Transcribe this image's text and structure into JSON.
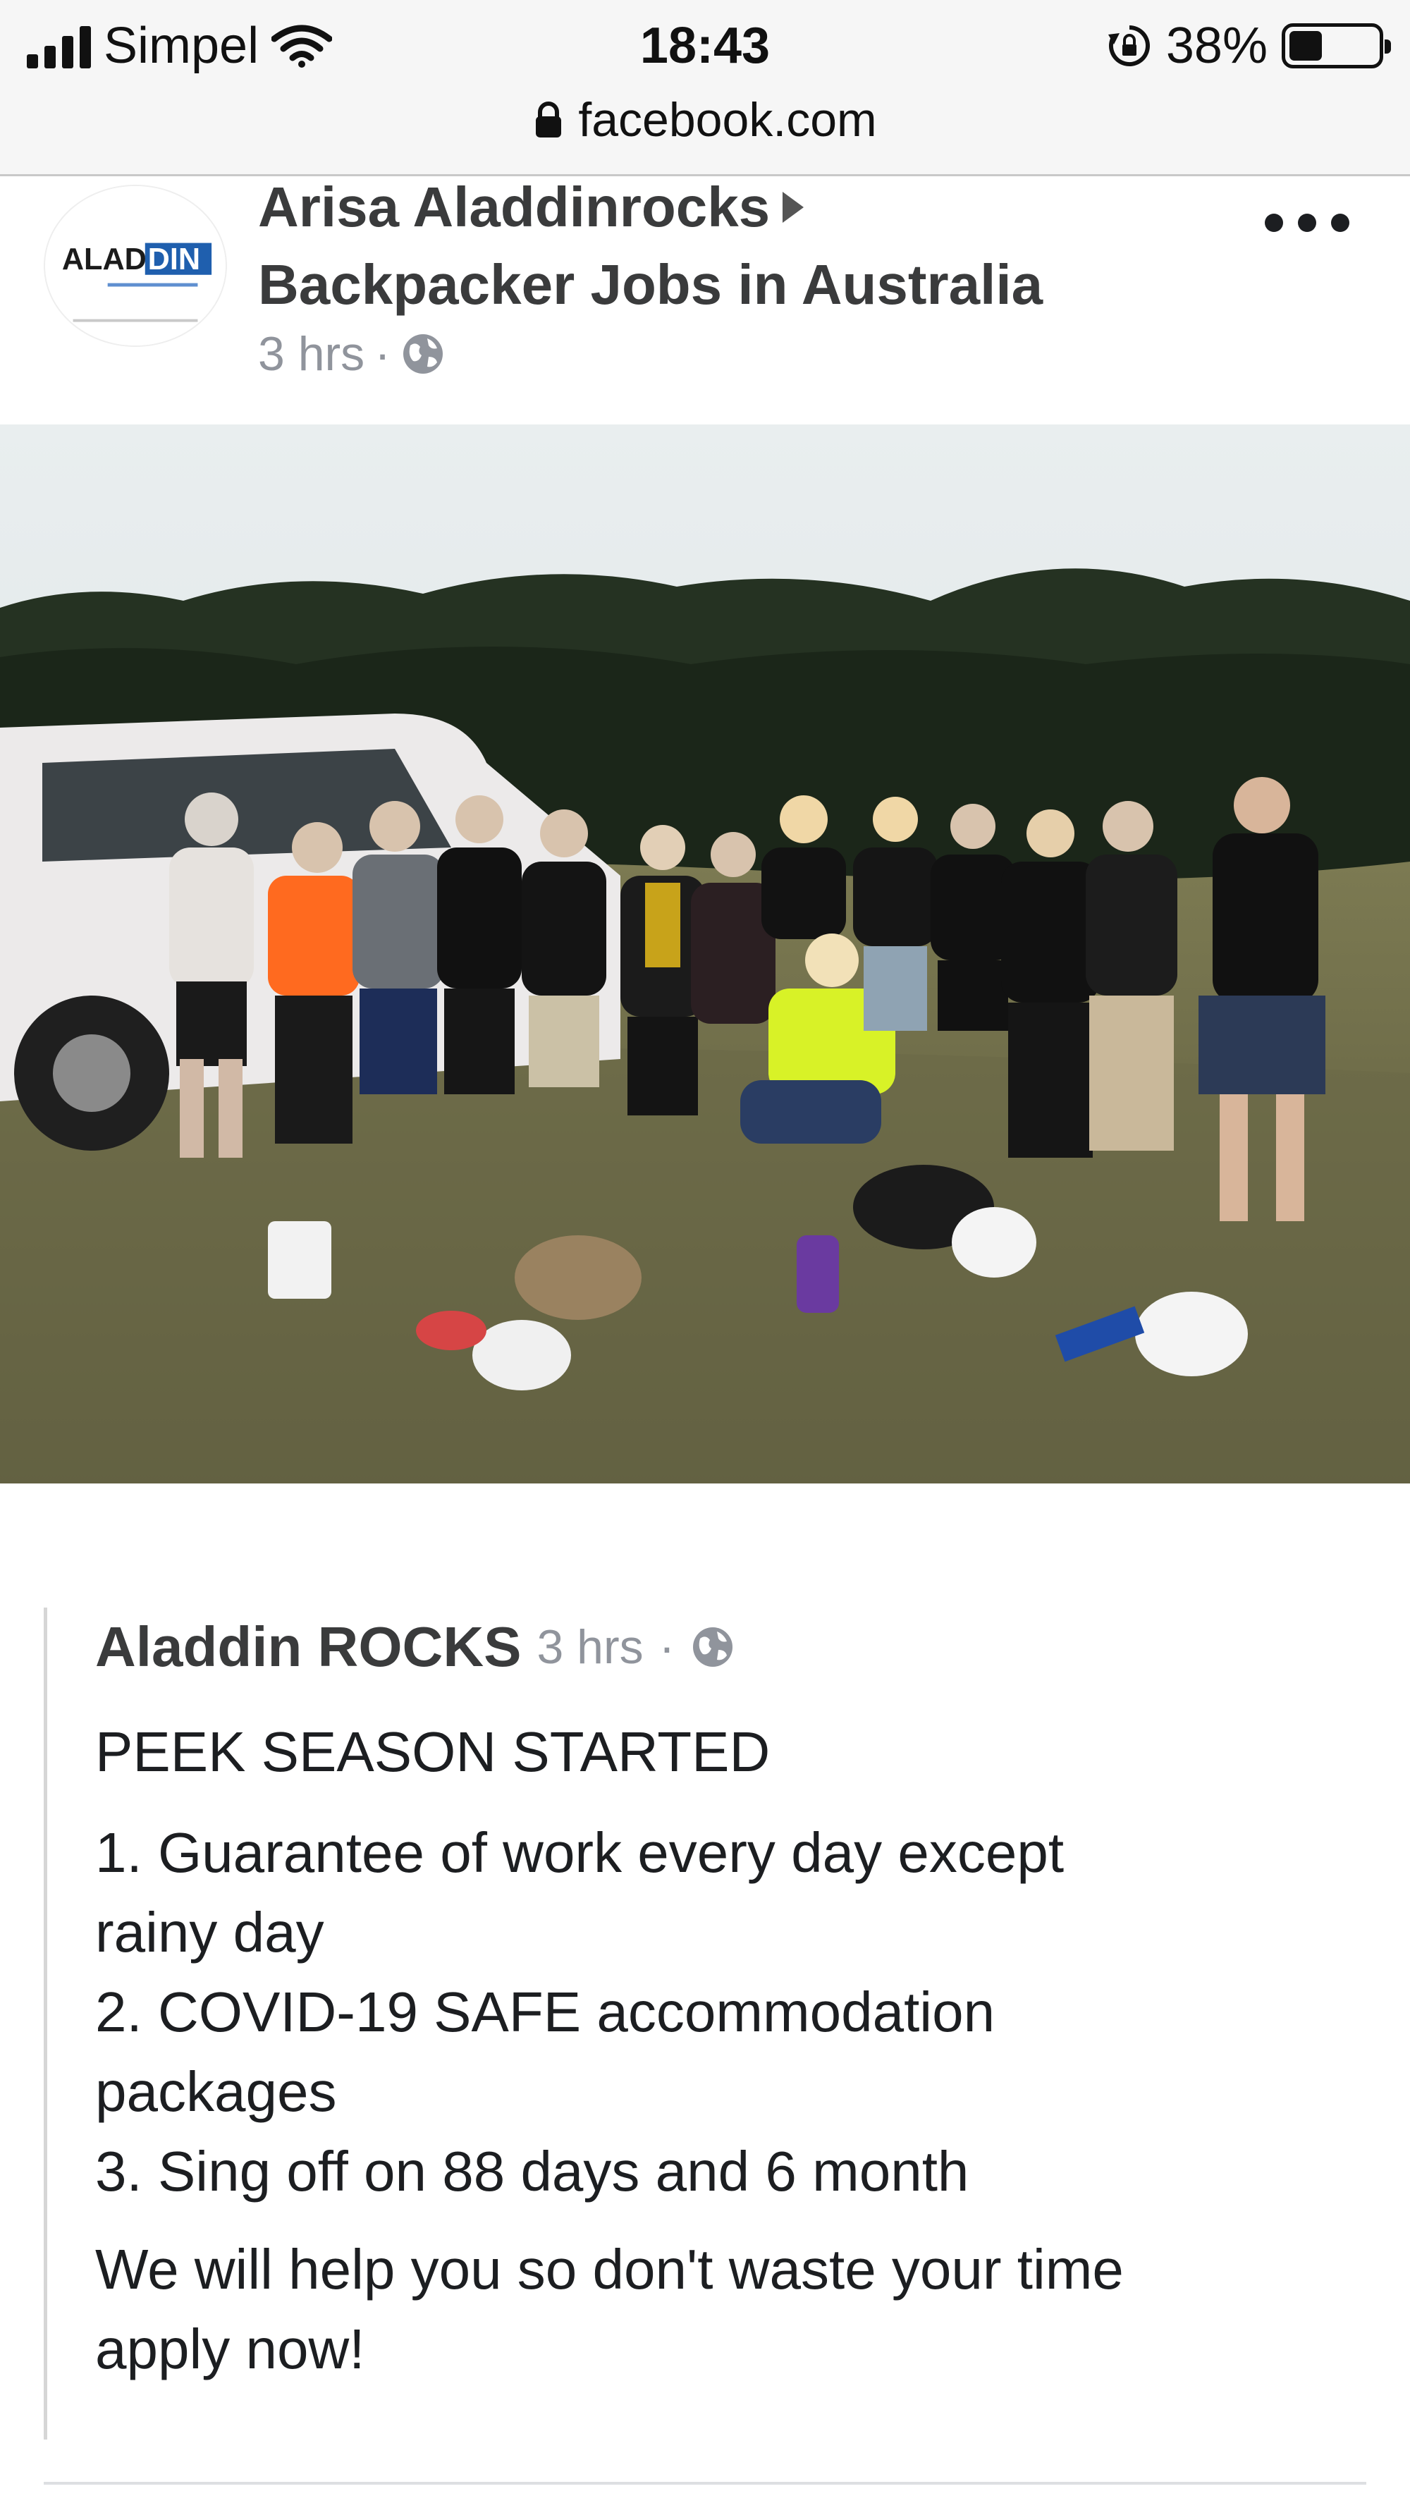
{
  "status_bar": {
    "carrier": "Simpel",
    "time": "18:43",
    "battery": "38%",
    "battery_level": 0.38
  },
  "browser": {
    "url": "facebook.com"
  },
  "post": {
    "author": "Arisa Aladdinrocks",
    "group": "Backpacker Jobs in Australia",
    "time": "3 hrs",
    "separator": "·",
    "avatar": {
      "logo_text_left": "ALAD",
      "logo_text_right": "DIN",
      "colors": {
        "dark": "#1b1b1b",
        "blue": "#1f5fae"
      }
    }
  },
  "shared_post": {
    "author": "Aladdin ROCKS",
    "time": "3 hrs",
    "separator": "·",
    "heading": "PEEK SEASON STARTED",
    "list_lines": [
      "1. Guarantee of work every day except",
      "rainy day",
      "2. COVID-19 SAFE accommodation",
      "packages",
      "3. Sing off on 88 days and 6 month"
    ],
    "closing_lines": [
      "We will help you so don't waste your time",
      "apply now!"
    ]
  },
  "icons": [
    "signal-icon",
    "wifi-icon",
    "rotation-lock-icon",
    "battery-icon",
    "lock-icon",
    "globe-icon",
    "more-icon",
    "arrow-right-icon"
  ],
  "colors": {
    "name_text": "#3a3b3c",
    "meta_text": "#90949c",
    "body_text": "#1c1e21",
    "status_bg": "#f6f6f6"
  }
}
